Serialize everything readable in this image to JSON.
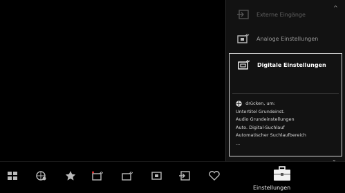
{
  "menu": {
    "items": [
      {
        "label": "Externe Eingänge",
        "icon": "input-icon"
      },
      {
        "label": "Analoge Einstellungen",
        "icon": "analog-tv-icon"
      },
      {
        "label": "Digitale Einstellungen",
        "icon": "digital-tv-icon"
      }
    ],
    "details": {
      "hint": "drücken, um:",
      "options": [
        "Untertitel Grundeinst.",
        "Audio Grundeinstellungen",
        "Auto. Digital-Suchlauf",
        "Automatischer Suchlaufbereich",
        "..."
      ]
    }
  },
  "bottom_bar": {
    "icons": [
      "apps-icon",
      "globe-icon",
      "star-icon",
      "tv-antenna-icon",
      "antenna-icon",
      "screen-icon",
      "input-icon",
      "heart-icon"
    ],
    "selected_label": "Einstellungen",
    "selected_icon": "toolbox-icon"
  },
  "colors": {
    "background": "#000000",
    "panel": "#121212",
    "selection_border": "#d8d8d8"
  }
}
